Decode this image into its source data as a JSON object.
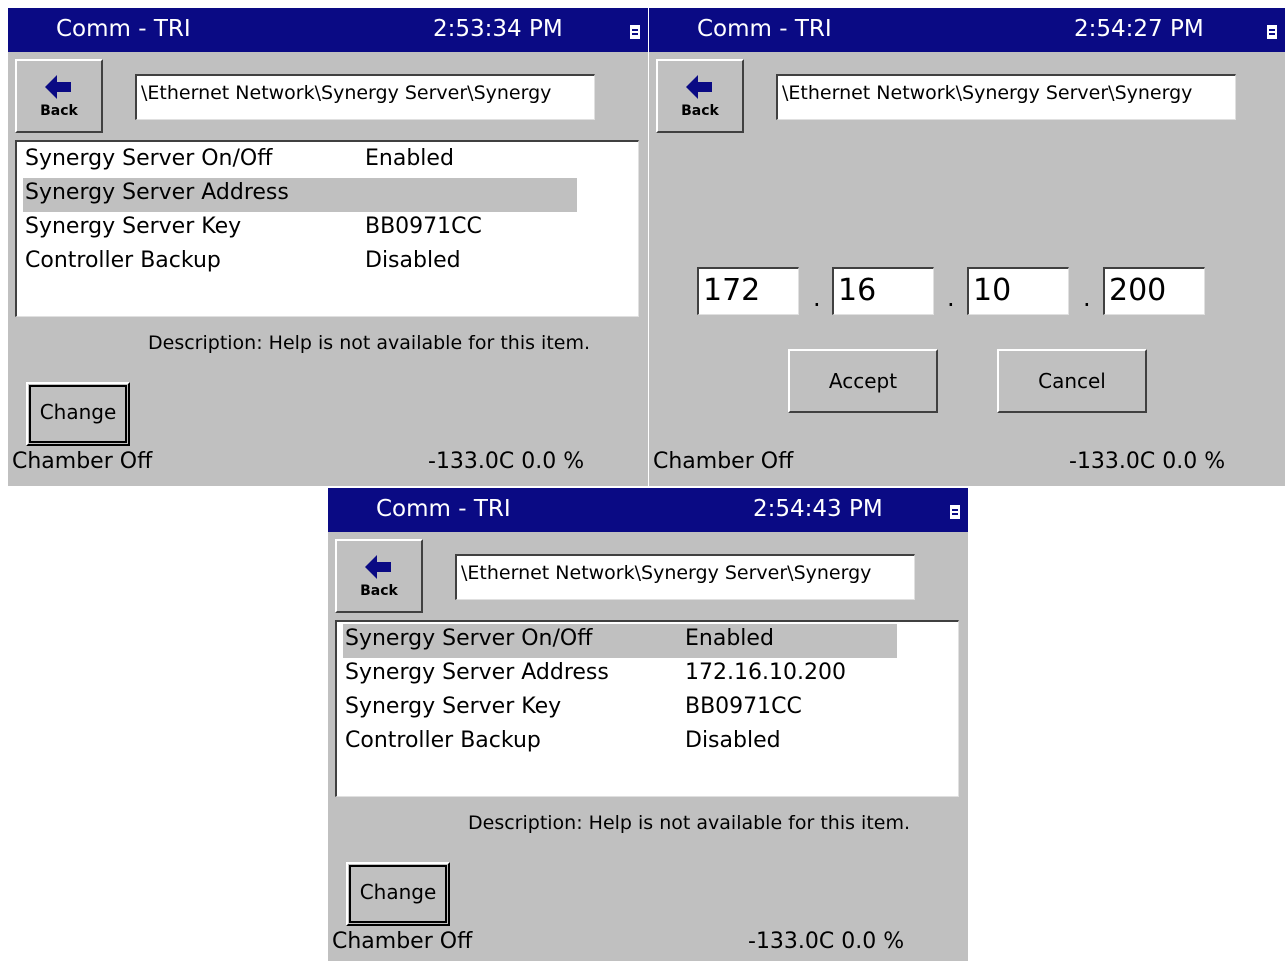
{
  "panels": [
    {
      "title": "Comm - TRI",
      "time": "2:53:34 PM",
      "back_label": "Back",
      "path": "\\Ethernet Network\\Synergy Server\\Synergy",
      "rows": [
        {
          "name": "Synergy Server On/Off",
          "value": "Enabled"
        },
        {
          "name": "Synergy Server Address",
          "value": ""
        },
        {
          "name": "Synergy Server Key",
          "value": "BB0971CC"
        },
        {
          "name": "Controller Backup",
          "value": "Disabled"
        }
      ],
      "selected_row": 1,
      "description": "Description:  Help is not available for this item.",
      "change_label": "Change",
      "status_left": "Chamber Off",
      "status_right": "-133.0C  0.0 %"
    },
    {
      "title": "Comm - TRI",
      "time": "2:54:27 PM",
      "back_label": "Back",
      "path": "\\Ethernet Network\\Synergy Server\\Synergy",
      "ip_octets": [
        "172",
        "16",
        "10",
        "200"
      ],
      "ip_separator": ".",
      "accept_label": "Accept",
      "cancel_label": "Cancel",
      "status_left": "Chamber Off",
      "status_right": "-133.0C  0.0 %"
    },
    {
      "title": "Comm - TRI",
      "time": "2:54:43 PM",
      "back_label": "Back",
      "path": "\\Ethernet Network\\Synergy Server\\Synergy",
      "rows": [
        {
          "name": "Synergy Server On/Off",
          "value": "Enabled"
        },
        {
          "name": "Synergy Server Address",
          "value": "172.16.10.200"
        },
        {
          "name": "Synergy Server Key",
          "value": "BB0971CC"
        },
        {
          "name": "Controller Backup",
          "value": "Disabled"
        }
      ],
      "selected_row": 0,
      "description": "Description:  Help is not available for this item.",
      "change_label": "Change",
      "status_left": "Chamber Off",
      "status_right": "-133.0C  0.0 %"
    }
  ],
  "colors": {
    "titlebar": "#0a0a84",
    "panel_bg": "#c0c0c0",
    "selection": "#c0c0c0"
  },
  "icons": {
    "back": "back-arrow-icon",
    "menu": "window-menu-icon"
  }
}
